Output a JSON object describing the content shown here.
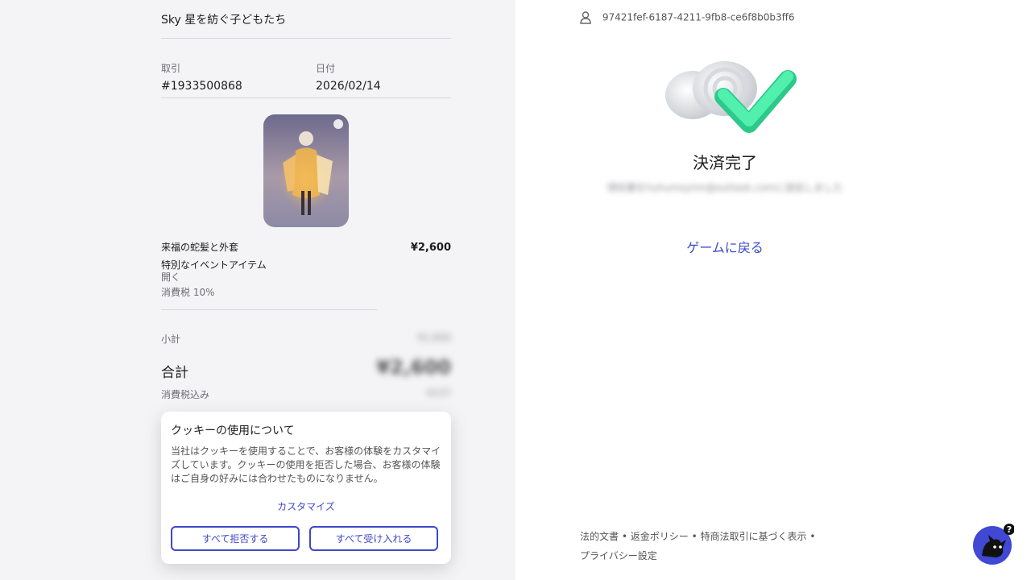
{
  "order": {
    "game_title": "Sky 星を紡ぐ子どもたち",
    "transaction_label": "取引",
    "transaction_value": "#1933500868",
    "date_label": "日付",
    "date_value": "2026/02/14",
    "item_name": "来福の蛇髪と外套",
    "item_price": "¥2,600",
    "item_type": "特別なイベントアイテム",
    "item_open": "開く",
    "item_tax": "消費税 10%",
    "subtotal_label": "小計",
    "subtotal_value": "¥2,600",
    "total_label": "合計",
    "total_value": "¥2,600",
    "tax_included_label": "消費税込み",
    "tax_included_value": "¥237"
  },
  "cookie": {
    "title": "クッキーの使用について",
    "body": "当社はクッキーを使用することで、お客様の体験をカスタマイズしています。クッキーの使用を拒否した場合、お客様の体験はご自身の好みには合わせたものになりません。",
    "customize": "カスタマイズ",
    "reject_all": "すべて拒否する",
    "accept_all": "すべて受け入れる"
  },
  "confirmation": {
    "user_id": "97421fef-6187-4211-9fb8-ce6f8b0b3ff6",
    "title": "決済完了",
    "email_note": "領収書をhuhumsynm@outlook.comに送信しました",
    "back_link": "ゲームに戻る"
  },
  "footer": {
    "legal": "法的文書",
    "refund": "返金ポリシー",
    "tokushoho": "特商法取引に基づく表示",
    "privacy": "プライバシー設定",
    "sep": "•"
  },
  "colors": {
    "accent": "#3d47c9",
    "check": "#3ee8a0",
    "left_bg": "#f4f4f6"
  },
  "icons": [
    "user-icon",
    "success-check-icon",
    "help-bot-icon"
  ]
}
